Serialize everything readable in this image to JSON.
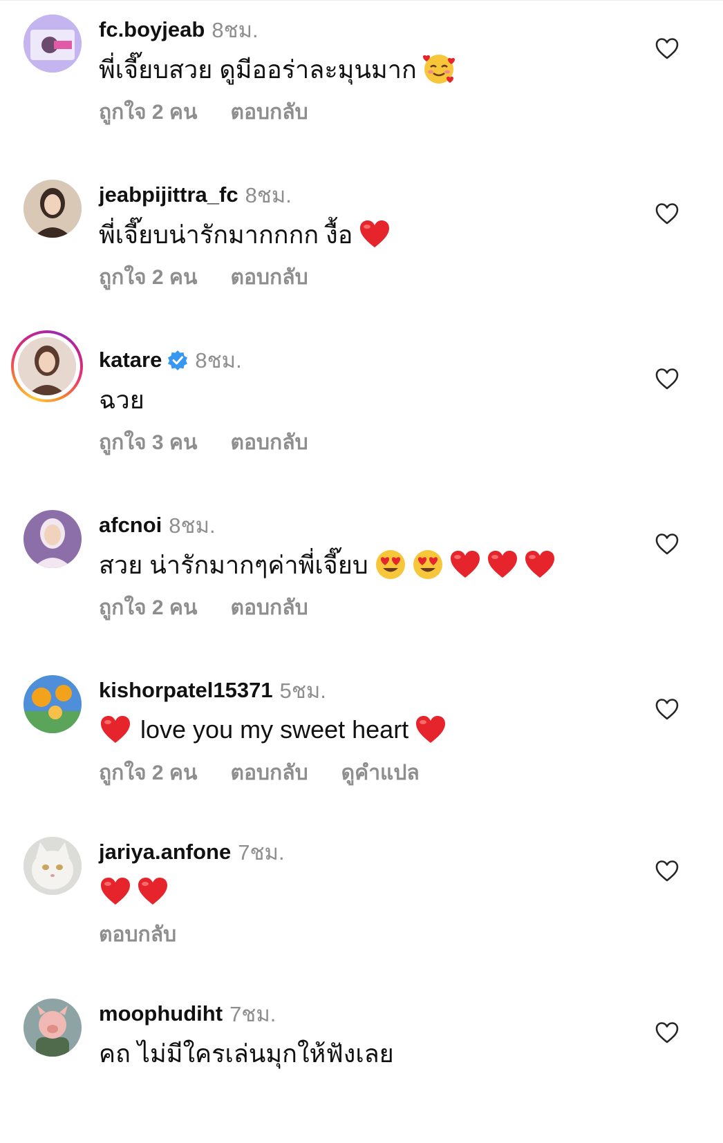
{
  "colors": {
    "text": "#111111",
    "muted": "#8e8e8e",
    "heart": "#e6242b",
    "verified": "#3897f0"
  },
  "comments": [
    {
      "username": "fc.boyjeab",
      "time": "8ชม.",
      "verified": false,
      "story_ring": false,
      "text": "พี่เจี๊ยบสวย ดูมีออร่าละมุนมาก",
      "trailing_emojis": [
        "smiling-face-with-hearts"
      ],
      "leading_emojis": [],
      "likes_label": "ถูกใจ 2 คน",
      "reply_label": "ตอบกลับ",
      "translate_label": "",
      "avatar": {
        "icon": "fan-page-avatar",
        "bg": "#c4b5f0",
        "fg": "#e15aa8"
      }
    },
    {
      "username": "jeabpijittra_fc",
      "time": "8ชม.",
      "verified": false,
      "story_ring": false,
      "text": "พี่เจี๊ยบน่ารักมากกกก งื้อ",
      "trailing_emojis": [
        "red-heart"
      ],
      "leading_emojis": [],
      "likes_label": "ถูกใจ 2 คน",
      "reply_label": "ตอบกลับ",
      "translate_label": "",
      "avatar": {
        "icon": "woman-portrait-avatar",
        "bg": "#d9c8b6",
        "fg": "#3a2a22"
      }
    },
    {
      "username": "katare",
      "time": "8ชม.",
      "verified": true,
      "story_ring": true,
      "text": "ฉวย",
      "trailing_emojis": [],
      "leading_emojis": [],
      "likes_label": "ถูกใจ 3 คน",
      "reply_label": "ตอบกลับ",
      "translate_label": "",
      "avatar": {
        "icon": "woman-portrait-avatar",
        "bg": "#e6d8cf",
        "fg": "#5a3b2e"
      }
    },
    {
      "username": "afcnoi",
      "time": "8ชม.",
      "verified": false,
      "story_ring": false,
      "text": "สวย น่ารักมากๆค่าพี่เจี๊ยบ",
      "trailing_emojis": [
        "heart-eyes",
        "heart-eyes",
        "red-heart",
        "red-heart",
        "red-heart"
      ],
      "leading_emojis": [],
      "likes_label": "ถูกใจ 2 คน",
      "reply_label": "ตอบกลับ",
      "translate_label": "",
      "avatar": {
        "icon": "girl-portrait-avatar",
        "bg": "#8c6fa8",
        "fg": "#f2e6f0"
      }
    },
    {
      "username": "kishorpatel15371",
      "time": "5ชม.",
      "verified": false,
      "story_ring": false,
      "text": "love you my sweet heart",
      "trailing_emojis": [
        "red-heart"
      ],
      "leading_emojis": [
        "red-heart"
      ],
      "likes_label": "ถูกใจ 2 คน",
      "reply_label": "ตอบกลับ",
      "translate_label": "ดูคำแปล",
      "avatar": {
        "icon": "flowers-avatar",
        "bg": "#4f8fd9",
        "fg": "#f3a21c"
      }
    },
    {
      "username": "jariya.anfone",
      "time": "7ชม.",
      "verified": false,
      "story_ring": false,
      "text": "",
      "trailing_emojis": [
        "red-heart",
        "red-heart"
      ],
      "leading_emojis": [],
      "likes_label": "",
      "reply_label": "ตอบกลับ",
      "translate_label": "",
      "avatar": {
        "icon": "cat-avatar",
        "bg": "#dcdcd8",
        "fg": "#f4f3ef"
      }
    },
    {
      "username": "moophudiht",
      "time": "7ชม.",
      "verified": false,
      "story_ring": false,
      "text": "คถ ไม่มีใครเล่นมุกให้ฟังเลย",
      "trailing_emojis": [],
      "leading_emojis": [],
      "likes_label": "",
      "reply_label": "",
      "translate_label": "",
      "avatar": {
        "icon": "pig-character-avatar",
        "bg": "#8ea4a4",
        "fg": "#f0b9b4"
      }
    }
  ]
}
